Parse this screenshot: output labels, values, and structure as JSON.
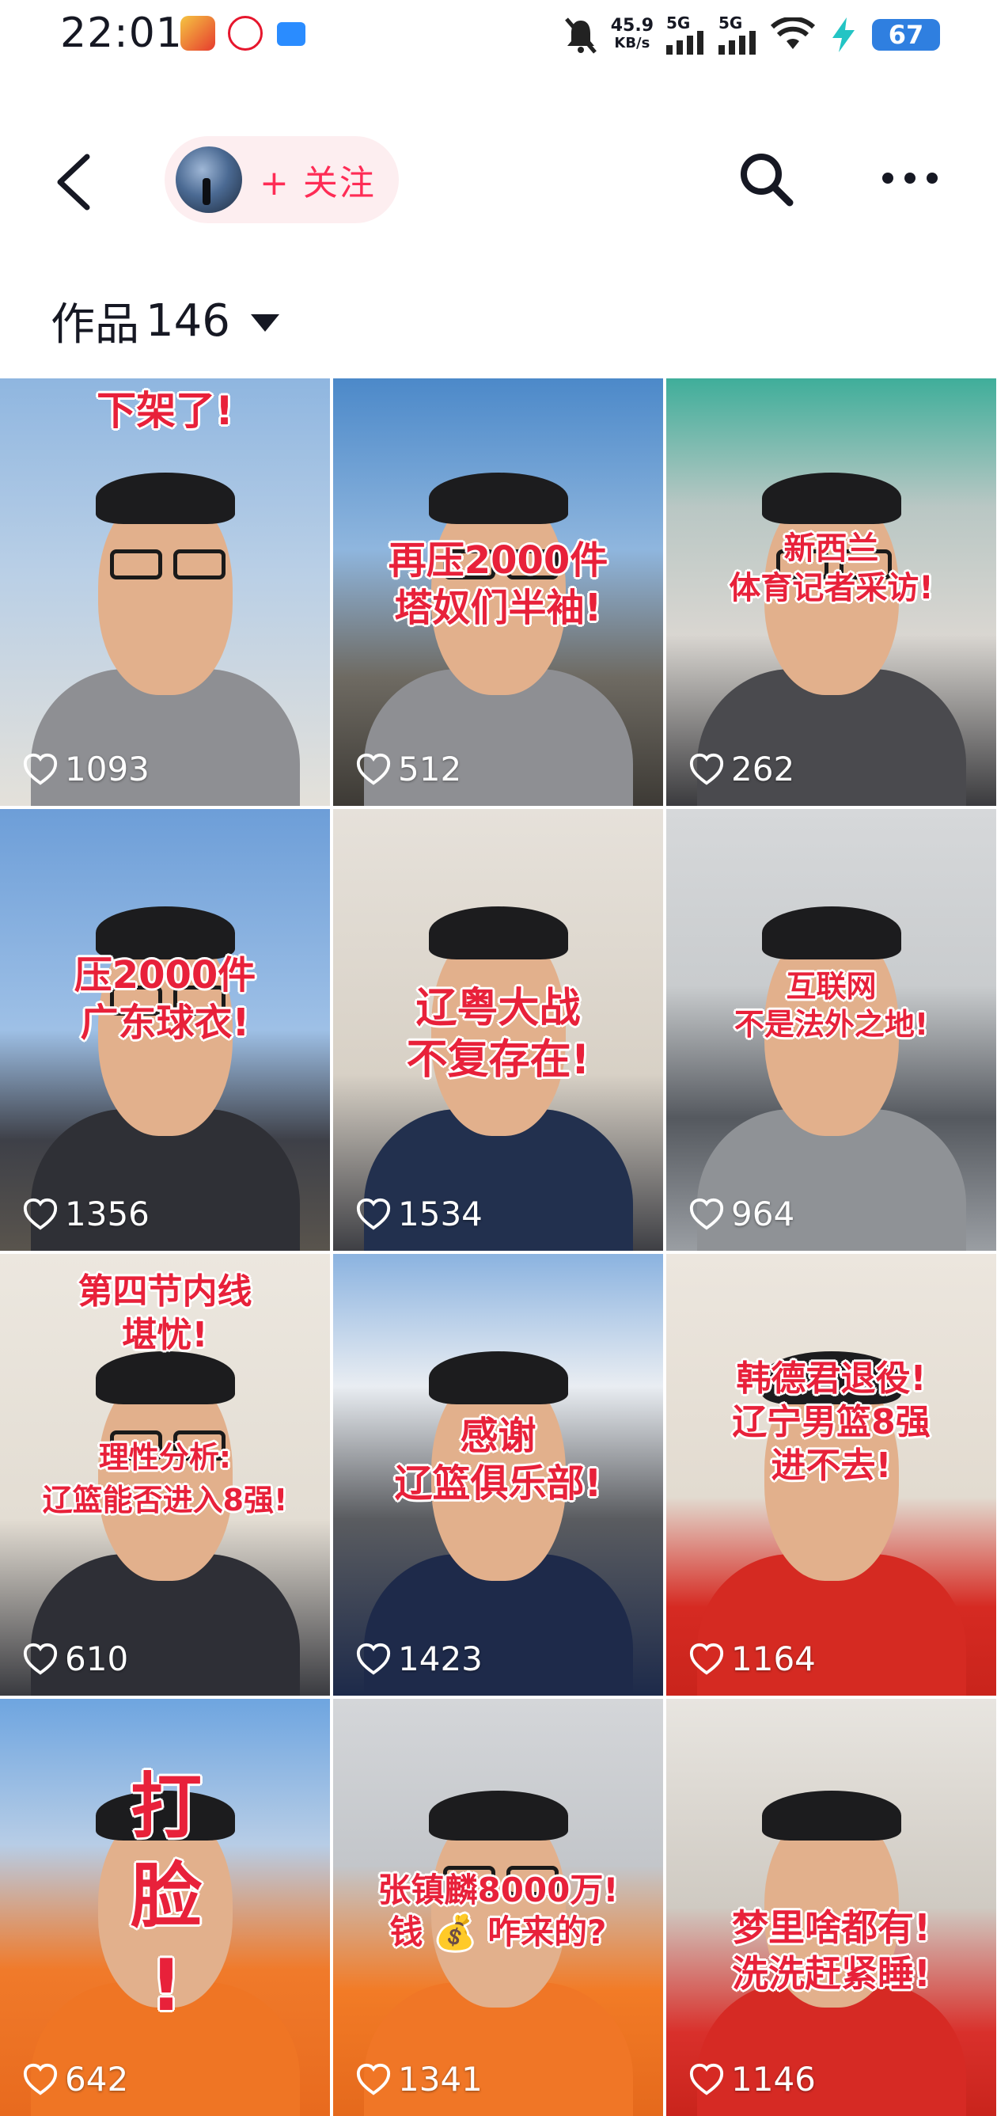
{
  "status_bar": {
    "time": "22:01",
    "net_speed_value": "45.9",
    "net_speed_unit": "KB/s",
    "network_1": "5G",
    "network_2": "5G",
    "battery": "67"
  },
  "nav": {
    "follow_label": "+ 关注"
  },
  "works": {
    "label": "作品",
    "count": "146"
  },
  "videos": [
    {
      "caption": "下架了!",
      "likes": "1093"
    },
    {
      "caption": "再压2000件\n塔奴们半袖!",
      "likes": "512"
    },
    {
      "caption": "新西兰\n体育记者采访!",
      "likes": "262"
    },
    {
      "caption": "压2000件\n广东球衣!",
      "likes": "1356"
    },
    {
      "caption": "辽粤大战\n不复存在!",
      "likes": "1534"
    },
    {
      "caption": "互联网\n不是法外之地!",
      "likes": "964"
    },
    {
      "caption": "第四节内线\n堪忧!",
      "caption2": "理性分析:\n辽篮能否进入8强!",
      "likes": "610"
    },
    {
      "caption": "感谢\n辽篮俱乐部!",
      "likes": "1423"
    },
    {
      "caption": "韩德君退役!\n辽宁男篮8强\n进不去!",
      "likes": "1164"
    },
    {
      "caption": "打\n脸\n!",
      "likes": "642"
    },
    {
      "caption": "张镇麟8000万!\n钱 💰 咋来的?",
      "likes": "1341"
    },
    {
      "caption": "梦里啥都有!\n洗洗赶紧睡!",
      "likes": "1146"
    }
  ]
}
